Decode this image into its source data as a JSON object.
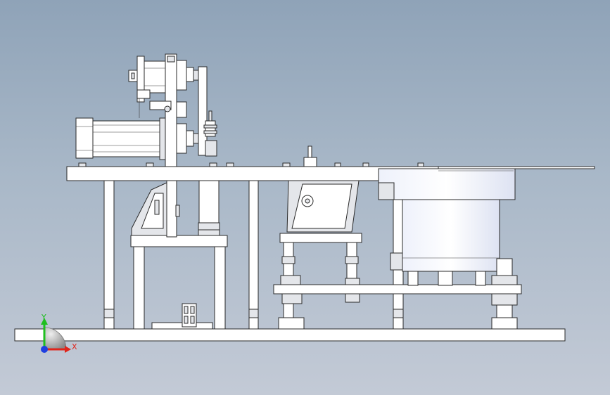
{
  "triad": {
    "y_label": "Y",
    "x_label": "X",
    "colors": {
      "x": "#e0251b",
      "y": "#1fbf1f",
      "z": "#1f3fe0"
    }
  },
  "colors": {
    "background_top": "#8fa3b8",
    "background_bottom": "#c3cad6",
    "part_fill": "#ffffff",
    "edge": "#2a2a2a"
  }
}
